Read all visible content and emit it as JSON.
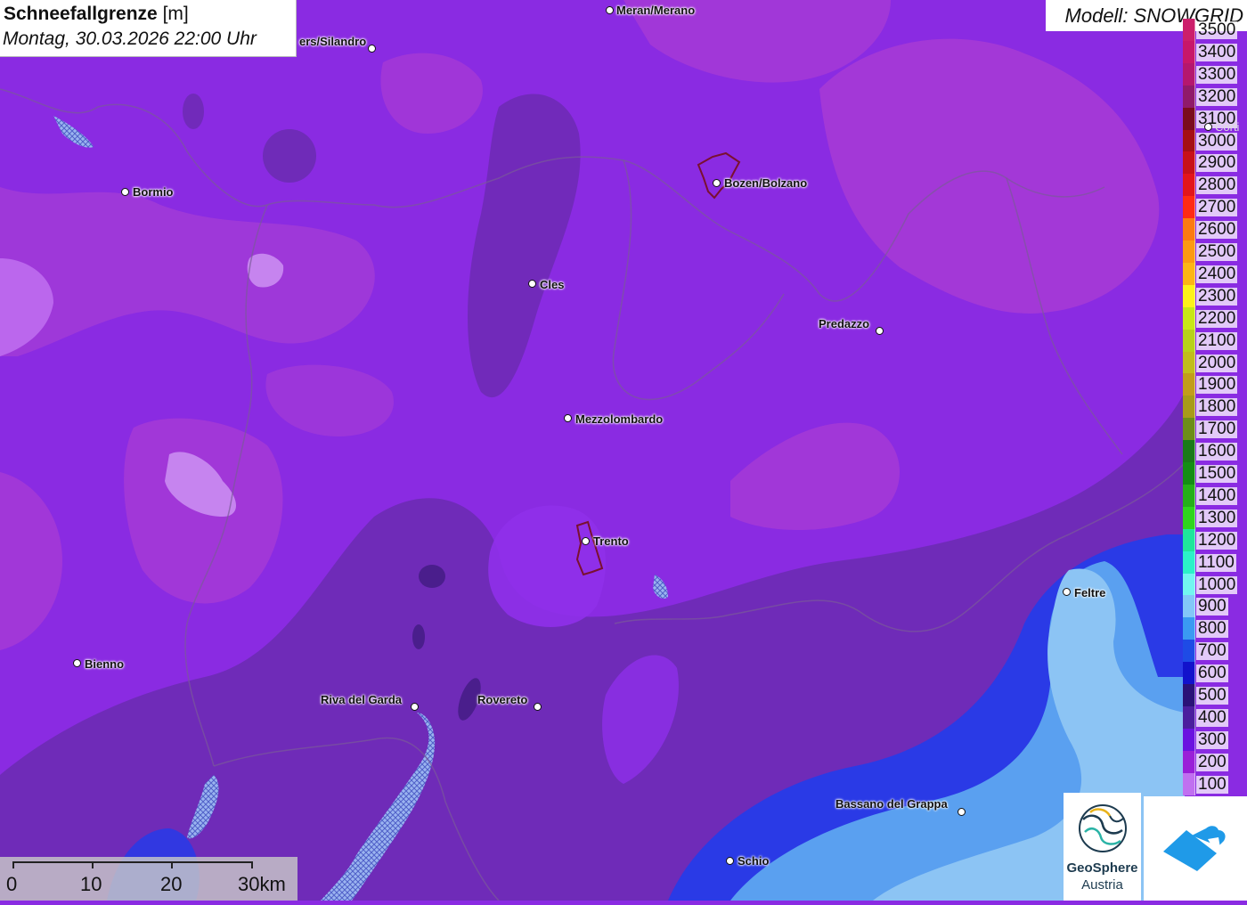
{
  "header": {
    "title": "Schneefallgrenze",
    "unit": "[m]",
    "datetime": "Montag, 30.03.2026 22:00 Uhr"
  },
  "model": {
    "label": "Modell: SNOWGRID"
  },
  "legend": {
    "items": [
      {
        "label": "3500",
        "color": "#cc1f6b"
      },
      {
        "label": "3400",
        "color": "#c8176a"
      },
      {
        "label": "3300",
        "color": "#b5176e"
      },
      {
        "label": "3200",
        "color": "#901a6a"
      },
      {
        "label": "3100",
        "color": "#7a0c1e"
      },
      {
        "label": "3000",
        "color": "#a50f15"
      },
      {
        "label": "2900",
        "color": "#c81119"
      },
      {
        "label": "2800",
        "color": "#e3151b"
      },
      {
        "label": "2700",
        "color": "#ff2a14"
      },
      {
        "label": "2600",
        "color": "#fc7a12"
      },
      {
        "label": "2500",
        "color": "#fd9a12"
      },
      {
        "label": "2400",
        "color": "#fdb515"
      },
      {
        "label": "2300",
        "color": "#fdf21a"
      },
      {
        "label": "2200",
        "color": "#c8e817"
      },
      {
        "label": "2100",
        "color": "#b7d21a"
      },
      {
        "label": "2000",
        "color": "#c1bd1c"
      },
      {
        "label": "1900",
        "color": "#c29d1b"
      },
      {
        "label": "1800",
        "color": "#a89b19"
      },
      {
        "label": "1700",
        "color": "#6d8e18"
      },
      {
        "label": "1600",
        "color": "#1a7a19"
      },
      {
        "label": "1500",
        "color": "#148e14"
      },
      {
        "label": "1400",
        "color": "#25b019"
      },
      {
        "label": "1300",
        "color": "#2fd51d"
      },
      {
        "label": "1200",
        "color": "#1fe69b"
      },
      {
        "label": "1100",
        "color": "#2bf2c8"
      },
      {
        "label": "1000",
        "color": "#72f6f0"
      },
      {
        "label": "900",
        "color": "#83c7f8"
      },
      {
        "label": "800",
        "color": "#3a9af2"
      },
      {
        "label": "700",
        "color": "#1e4be6"
      },
      {
        "label": "600",
        "color": "#1212cc"
      },
      {
        "label": "500",
        "color": "#2a1278"
      },
      {
        "label": "400",
        "color": "#4b1e9e"
      },
      {
        "label": "300",
        "color": "#6a12e0"
      },
      {
        "label": "200",
        "color": "#9a1fd8"
      },
      {
        "label": "100",
        "color": "#c070f0"
      }
    ]
  },
  "cities": [
    {
      "name": "Meran/Merano"
    },
    {
      "name": "...ers/Silandro",
      "display": "ers/Silandro"
    },
    {
      "name": "Bormio"
    },
    {
      "name": "Bozen/Bolzano"
    },
    {
      "name": "Cles"
    },
    {
      "name": "Predazzo"
    },
    {
      "name": "Mezzolombardo"
    },
    {
      "name": "Trento"
    },
    {
      "name": "Feltre"
    },
    {
      "name": "Bienno"
    },
    {
      "name": "Riva del Garda"
    },
    {
      "name": "Rovereto"
    },
    {
      "name": "Bassano del Grappa"
    },
    {
      "name": "Schio"
    },
    {
      "name": "Corti..."
    }
  ],
  "city_labels": {
    "merano": "Meran/Merano",
    "silandro": "ers/Silandro",
    "bormio": "Bormio",
    "bolzano": "Bozen/Bolzano",
    "cles": "Cles",
    "predazzo": "Predazzo",
    "mezzolombardo": "Mezzolombardo",
    "trento": "Trento",
    "feltre": "Feltre",
    "bienno": "Bienno",
    "riva": "Riva del Garda",
    "rovereto": "Rovereto",
    "bassano": "Bassano del Grappa",
    "schio": "Schio",
    "cortina": "Corti"
  },
  "scale": {
    "labels": [
      "0",
      "10",
      "20",
      "30km"
    ]
  },
  "logos": {
    "geosphere_line1": "GeoSphere",
    "geosphere_line2": "Austria"
  },
  "colors": {
    "base_purple": "#8a2be2",
    "light_purple": "#a04bf0",
    "magenta": "#b03ad6",
    "dark_purple": "#6a2bb0",
    "darker_purple": "#5a2a9a",
    "blue": "#2a3ae6",
    "light_blue": "#5aa0f0",
    "pale_blue": "#8cc4f4"
  }
}
